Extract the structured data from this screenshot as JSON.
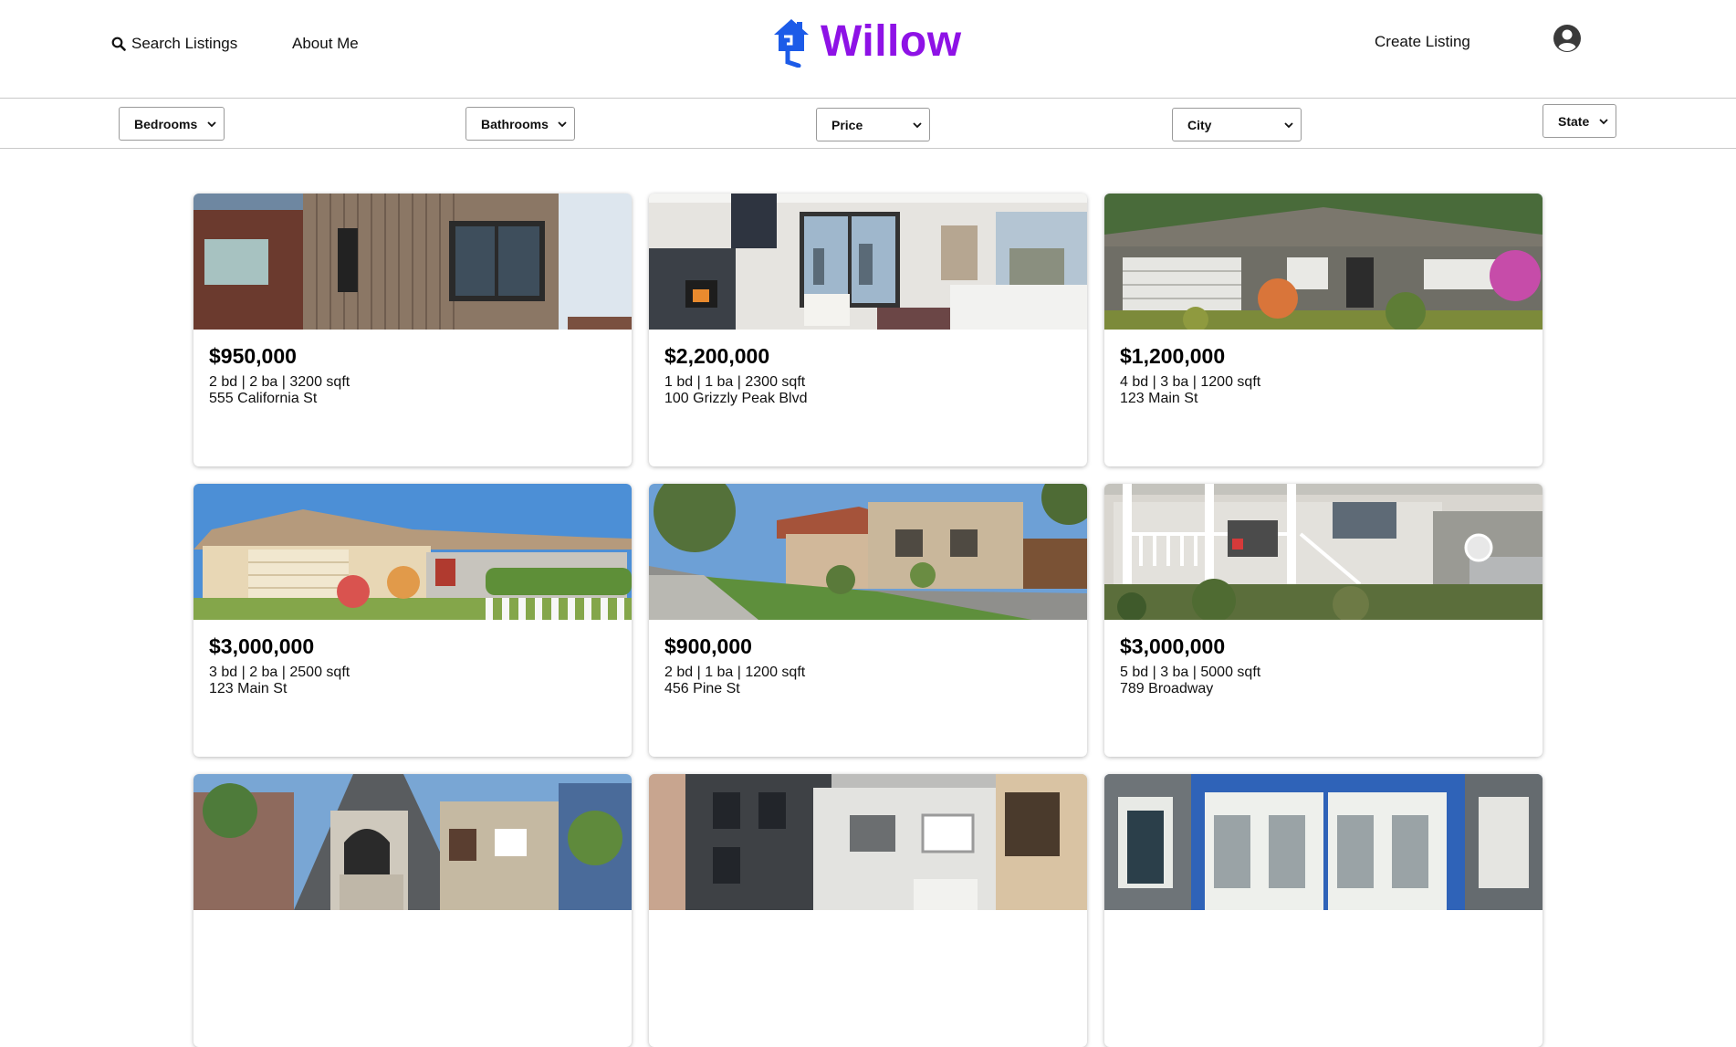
{
  "header": {
    "search_label": "Search Listings",
    "about_label": "About Me",
    "logo_text": "Willow",
    "create_label": "Create Listing",
    "brand_color": "#8e12e6",
    "logo_icon_color": "#1c5be8",
    "icons": [
      "search-icon",
      "house-logo-icon",
      "user-avatar-icon"
    ]
  },
  "filters": {
    "bedrooms": "Bedrooms",
    "bathrooms": "Bathrooms",
    "price": "Price",
    "city": "City",
    "state": "State"
  },
  "listings": [
    {
      "price": "$950,000",
      "meta": "2 bd | 2 ba | 3200 sqft",
      "address": "555 California St"
    },
    {
      "price": "$2,200,000",
      "meta": "1 bd | 1 ba | 2300 sqft",
      "address": "100 Grizzly Peak Blvd"
    },
    {
      "price": "$1,200,000",
      "meta": "4 bd | 3 ba | 1200 sqft",
      "address": "123 Main St"
    },
    {
      "price": "$3,000,000",
      "meta": "3 bd | 2 ba | 2500 sqft",
      "address": "123 Main St"
    },
    {
      "price": "$900,000",
      "meta": "2 bd | 1 ba | 1200 sqft",
      "address": "456 Pine St"
    },
    {
      "price": "$3,000,000",
      "meta": "5 bd | 3 ba | 5000 sqft",
      "address": "789 Broadway"
    },
    {
      "price": "",
      "meta": "",
      "address": ""
    },
    {
      "price": "",
      "meta": "",
      "address": ""
    },
    {
      "price": "",
      "meta": "",
      "address": ""
    }
  ]
}
